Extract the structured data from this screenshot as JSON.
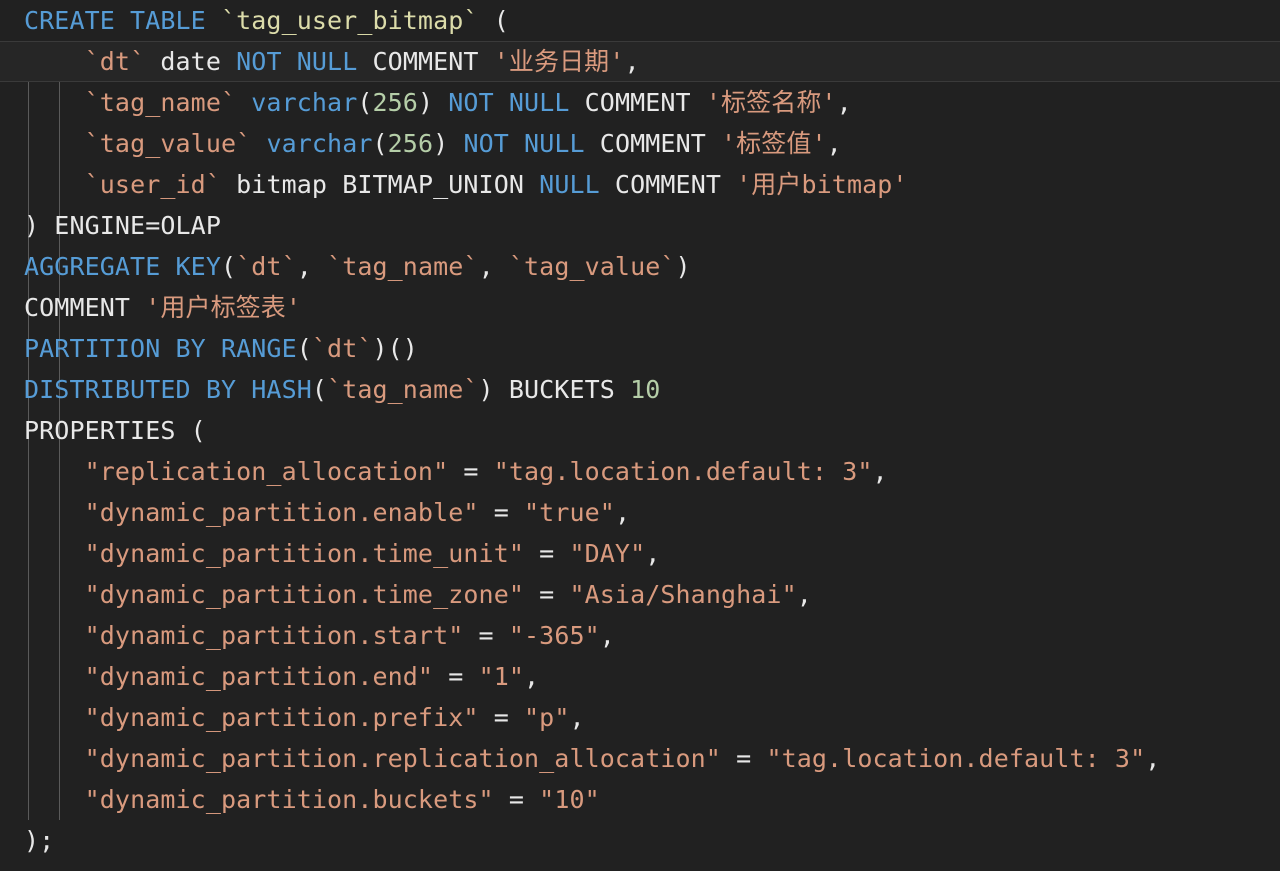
{
  "editor": {
    "language": "sql",
    "background_color": "#212121",
    "font_size_px": 25,
    "line_height_px": 41,
    "active_line_index": 1,
    "colors": {
      "keyword": "#569cd6",
      "table_name": "#dcdcaa",
      "identifier": "#d99a7e",
      "string": "#d99a7e",
      "number": "#b5cea8",
      "plain_text": "#e8e8e8",
      "indent_guide": "#5a5a5a",
      "active_line_background": "#262626"
    },
    "indent_guides_x": [
      28,
      59
    ]
  },
  "code": {
    "title": "CREATE TABLE tag_user_bitmap",
    "lines": [
      {
        "id": "line-1",
        "tokens": [
          {
            "t": "CREATE TABLE ",
            "c": "kw"
          },
          {
            "t": "`tag_user_bitmap`",
            "c": "tbl"
          },
          {
            "t": " (",
            "c": "plain"
          }
        ]
      },
      {
        "id": "line-2",
        "active": true,
        "tokens": [
          {
            "t": "    ",
            "c": "plain"
          },
          {
            "t": "`dt`",
            "c": "ident"
          },
          {
            "t": " date ",
            "c": "plain"
          },
          {
            "t": "NOT NULL",
            "c": "kw"
          },
          {
            "t": " COMMENT ",
            "c": "plain"
          },
          {
            "t": "'业务日期'",
            "c": "str"
          },
          {
            "t": ",",
            "c": "plain"
          }
        ]
      },
      {
        "id": "line-3",
        "tokens": [
          {
            "t": "    ",
            "c": "plain"
          },
          {
            "t": "`tag_name`",
            "c": "ident"
          },
          {
            "t": " ",
            "c": "plain"
          },
          {
            "t": "varchar",
            "c": "kw"
          },
          {
            "t": "(",
            "c": "plain"
          },
          {
            "t": "256",
            "c": "num"
          },
          {
            "t": ") ",
            "c": "plain"
          },
          {
            "t": "NOT NULL",
            "c": "kw"
          },
          {
            "t": " COMMENT ",
            "c": "plain"
          },
          {
            "t": "'标签名称'",
            "c": "str"
          },
          {
            "t": ",",
            "c": "plain"
          }
        ]
      },
      {
        "id": "line-4",
        "tokens": [
          {
            "t": "    ",
            "c": "plain"
          },
          {
            "t": "`tag_value`",
            "c": "ident"
          },
          {
            "t": " ",
            "c": "plain"
          },
          {
            "t": "varchar",
            "c": "kw"
          },
          {
            "t": "(",
            "c": "plain"
          },
          {
            "t": "256",
            "c": "num"
          },
          {
            "t": ") ",
            "c": "plain"
          },
          {
            "t": "NOT NULL",
            "c": "kw"
          },
          {
            "t": " COMMENT ",
            "c": "plain"
          },
          {
            "t": "'标签值'",
            "c": "str"
          },
          {
            "t": ",",
            "c": "plain"
          }
        ]
      },
      {
        "id": "line-5",
        "tokens": [
          {
            "t": "    ",
            "c": "plain"
          },
          {
            "t": "`user_id`",
            "c": "ident"
          },
          {
            "t": " bitmap BITMAP_UNION ",
            "c": "plain"
          },
          {
            "t": "NULL",
            "c": "kw"
          },
          {
            "t": " COMMENT ",
            "c": "plain"
          },
          {
            "t": "'用户bitmap'",
            "c": "str"
          }
        ]
      },
      {
        "id": "line-6",
        "tokens": [
          {
            "t": ") ENGINE=OLAP",
            "c": "plain"
          }
        ]
      },
      {
        "id": "line-7",
        "tokens": [
          {
            "t": "AGGREGATE KEY",
            "c": "kw"
          },
          {
            "t": "(",
            "c": "plain"
          },
          {
            "t": "`dt`",
            "c": "ident"
          },
          {
            "t": ", ",
            "c": "plain"
          },
          {
            "t": "`tag_name`",
            "c": "ident"
          },
          {
            "t": ", ",
            "c": "plain"
          },
          {
            "t": "`tag_value`",
            "c": "ident"
          },
          {
            "t": ")",
            "c": "plain"
          }
        ]
      },
      {
        "id": "line-8",
        "tokens": [
          {
            "t": "COMMENT ",
            "c": "plain"
          },
          {
            "t": "'用户标签表'",
            "c": "str"
          }
        ]
      },
      {
        "id": "line-9",
        "tokens": [
          {
            "t": "PARTITION BY RANGE",
            "c": "kw"
          },
          {
            "t": "(",
            "c": "plain"
          },
          {
            "t": "`dt`",
            "c": "ident"
          },
          {
            "t": ")()",
            "c": "plain"
          }
        ]
      },
      {
        "id": "line-10",
        "tokens": [
          {
            "t": "DISTRIBUTED BY HASH",
            "c": "kw"
          },
          {
            "t": "(",
            "c": "plain"
          },
          {
            "t": "`tag_name`",
            "c": "ident"
          },
          {
            "t": ") BUCKETS ",
            "c": "plain"
          },
          {
            "t": "10",
            "c": "num"
          }
        ]
      },
      {
        "id": "line-11",
        "tokens": [
          {
            "t": "PROPERTIES (",
            "c": "plain"
          }
        ]
      },
      {
        "id": "line-12",
        "tokens": [
          {
            "t": "    ",
            "c": "plain"
          },
          {
            "t": "\"replication_allocation\"",
            "c": "str"
          },
          {
            "t": " = ",
            "c": "plain"
          },
          {
            "t": "\"tag.location.default: 3\"",
            "c": "str"
          },
          {
            "t": ",",
            "c": "plain"
          }
        ]
      },
      {
        "id": "line-13",
        "tokens": [
          {
            "t": "    ",
            "c": "plain"
          },
          {
            "t": "\"dynamic_partition.enable\"",
            "c": "str"
          },
          {
            "t": " = ",
            "c": "plain"
          },
          {
            "t": "\"true\"",
            "c": "str"
          },
          {
            "t": ",",
            "c": "plain"
          }
        ]
      },
      {
        "id": "line-14",
        "tokens": [
          {
            "t": "    ",
            "c": "plain"
          },
          {
            "t": "\"dynamic_partition.time_unit\"",
            "c": "str"
          },
          {
            "t": " = ",
            "c": "plain"
          },
          {
            "t": "\"DAY\"",
            "c": "str"
          },
          {
            "t": ",",
            "c": "plain"
          }
        ]
      },
      {
        "id": "line-15",
        "tokens": [
          {
            "t": "    ",
            "c": "plain"
          },
          {
            "t": "\"dynamic_partition.time_zone\"",
            "c": "str"
          },
          {
            "t": " = ",
            "c": "plain"
          },
          {
            "t": "\"Asia/Shanghai\"",
            "c": "str"
          },
          {
            "t": ",",
            "c": "plain"
          }
        ]
      },
      {
        "id": "line-16",
        "tokens": [
          {
            "t": "    ",
            "c": "plain"
          },
          {
            "t": "\"dynamic_partition.start\"",
            "c": "str"
          },
          {
            "t": " = ",
            "c": "plain"
          },
          {
            "t": "\"-365\"",
            "c": "str"
          },
          {
            "t": ",",
            "c": "plain"
          }
        ]
      },
      {
        "id": "line-17",
        "tokens": [
          {
            "t": "    ",
            "c": "plain"
          },
          {
            "t": "\"dynamic_partition.end\"",
            "c": "str"
          },
          {
            "t": " = ",
            "c": "plain"
          },
          {
            "t": "\"1\"",
            "c": "str"
          },
          {
            "t": ",",
            "c": "plain"
          }
        ]
      },
      {
        "id": "line-18",
        "tokens": [
          {
            "t": "    ",
            "c": "plain"
          },
          {
            "t": "\"dynamic_partition.prefix\"",
            "c": "str"
          },
          {
            "t": " = ",
            "c": "plain"
          },
          {
            "t": "\"p\"",
            "c": "str"
          },
          {
            "t": ",",
            "c": "plain"
          }
        ]
      },
      {
        "id": "line-19",
        "tokens": [
          {
            "t": "    ",
            "c": "plain"
          },
          {
            "t": "\"dynamic_partition.replication_allocation\"",
            "c": "str"
          },
          {
            "t": " = ",
            "c": "plain"
          },
          {
            "t": "\"tag.location.default: 3\"",
            "c": "str"
          },
          {
            "t": ",",
            "c": "plain"
          }
        ]
      },
      {
        "id": "line-20",
        "tokens": [
          {
            "t": "    ",
            "c": "plain"
          },
          {
            "t": "\"dynamic_partition.buckets\"",
            "c": "str"
          },
          {
            "t": " = ",
            "c": "plain"
          },
          {
            "t": "\"10\"",
            "c": "str"
          }
        ]
      },
      {
        "id": "line-21",
        "tokens": [
          {
            "t": ");",
            "c": "plain"
          }
        ]
      }
    ]
  }
}
